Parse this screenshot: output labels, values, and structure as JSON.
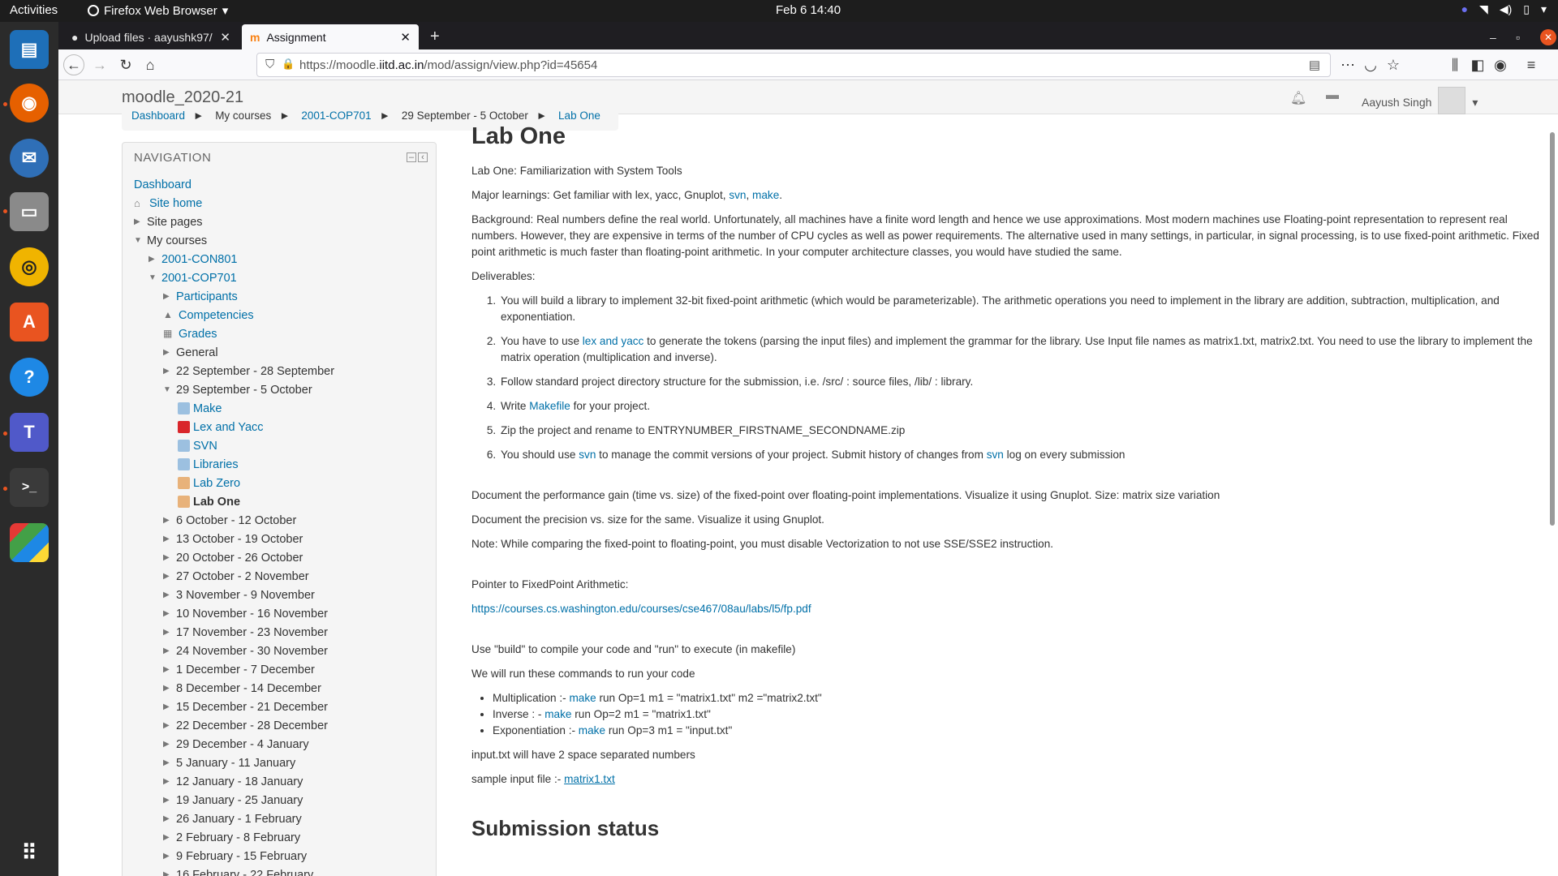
{
  "topbar": {
    "activities": "Activities",
    "app_name": "Firefox Web Browser",
    "clock": "Feb 6  14:40"
  },
  "dock": {
    "items": [
      "writer-icon",
      "firefox-icon",
      "thunderbird-icon",
      "files-icon",
      "rhythmbox-icon",
      "software-icon",
      "help-icon",
      "teams-icon",
      "terminal-icon",
      "office-icon",
      "apps-grid-icon"
    ]
  },
  "browser": {
    "tabs": [
      {
        "label": "Upload files · aayushk97/",
        "active": false
      },
      {
        "label": "Assignment",
        "active": true
      }
    ],
    "url_prefix": "https://moodle.",
    "url_domain": "iitd.ac.in",
    "url_path": "/mod/assign/view.php?id=45654"
  },
  "moodle": {
    "site_name": "moodle_2020-21",
    "user_name": "Aayush Singh",
    "breadcrumb": [
      "Dashboard",
      "My courses",
      "2001-COP701",
      "29 September - 5 October",
      "Lab One"
    ]
  },
  "navigation": {
    "title": "NAVIGATION",
    "dashboard": "Dashboard",
    "site_home": "Site home",
    "site_pages": "Site pages",
    "my_courses": "My courses",
    "course1": "2001-CON801",
    "course2": "2001-COP701",
    "participants": "Participants",
    "competencies": "Competencies",
    "grades": "Grades",
    "general": "General",
    "week_sep22": "22 September - 28 September",
    "week_sep29": "29 September - 5 October",
    "activities": [
      "Make",
      "Lex and Yacc",
      "SVN",
      "Libraries",
      "Lab Zero",
      "Lab One"
    ],
    "weeks": [
      "6 October - 12 October",
      "13 October - 19 October",
      "20 October - 26 October",
      "27 October - 2 November",
      "3 November - 9 November",
      "10 November - 16 November",
      "17 November - 23 November",
      "24 November - 30 November",
      "1 December - 7 December",
      "8 December - 14 December",
      "15 December - 21 December",
      "22 December - 28 December",
      "29 December - 4 January",
      "5 January - 11 January",
      "12 January - 18 January",
      "19 January - 25 January",
      "26 January - 1 February",
      "2 February - 8 February",
      "9 February - 15 February",
      "16 February - 22 February"
    ]
  },
  "content": {
    "title": "Lab One",
    "intro": "Lab One: Familiarization with System Tools",
    "learnings_prefix": "Major learnings: Get familiar with lex, yacc, Gnuplot, ",
    "learnings_svn": "svn",
    "learnings_sep": ", ",
    "learnings_make": "make",
    "learnings_end": ".",
    "background": "Background:  Real numbers define the real world. Unfortunately, all machines have a finite word length and hence we use approximations. Most modern machines use Floating-point representation to represent real numbers. However, they are expensive in terms of the number of CPU cycles as well as power requirements. The alternative used in many settings, in particular, in signal processing, is to use fixed-point arithmetic. Fixed point arithmetic is much faster than floating-point arithmetic. In your computer architecture classes, you would have studied the same.",
    "deliverables_label": "Deliverables:",
    "d1": "You will build a library to implement 32-bit fixed-point arithmetic (which would be parameterizable). The arithmetic operations you need to implement in the library are addition, subtraction, multiplication, and exponentiation.",
    "d2_pre": "You have to use ",
    "d2_link": "lex and yacc",
    "d2_post": " to generate the tokens (parsing the input files) and implement the grammar for the library. Use Input file names as matrix1.txt, matrix2.txt. You need to use the library to implement the matrix operation (multiplication and inverse).",
    "d3": "Follow standard project directory structure for the submission, i.e. /src/ : source files, /lib/ : library.",
    "d4_pre": "Write ",
    "d4_link": "Makefile",
    "d4_post": " for your project.",
    "d5": "Zip the project and rename to ENTRYNUMBER_FIRSTNAME_SECONDNAME.zip",
    "d6_pre": "You should use ",
    "d6_link1": "svn",
    "d6_mid": " to manage the commit versions of your project. Submit history of changes from ",
    "d6_link2": "svn",
    "d6_post": " log on every submission",
    "perf": "Document the performance gain (time vs. size) of the fixed-point over floating-point implementations. Visualize it using Gnuplot. Size: matrix size variation",
    "precision": "Document the precision vs. size for the same. Visualize it using Gnuplot.",
    "note": "Note: While comparing the fixed-point to floating-point, you must disable Vectorization  to not use SSE/SSE2 instruction.",
    "pointer_label": "Pointer to FixedPoint Arithmetic:",
    "pointer_url": "https://courses.cs.washington.edu/courses/cse467/08au/labs/l5/fp.pdf",
    "build_info": "Use \"build\" to compile your code and \"run\" to execute (in makefile)",
    "run_info": "We will run these commands to run your code",
    "cmd1_pre": "Multiplication :- ",
    "cmd1_post": " run Op=1 m1 = \"matrix1.txt\" m2 =\"matrix2.txt\"",
    "cmd2_pre": "Inverse : - ",
    "cmd2_post": " run Op=2 m1 = \"matrix1.txt\"",
    "cmd3_pre": "Exponentiation :- ",
    "cmd3_post": " run Op=3 m1 = \"input.txt\"",
    "make_word": "make",
    "input_info": "input.txt will have 2 space separated numbers",
    "sample_pre": "sample input file :- ",
    "sample_link": "matrix1.txt",
    "submission_heading": "Submission status"
  }
}
